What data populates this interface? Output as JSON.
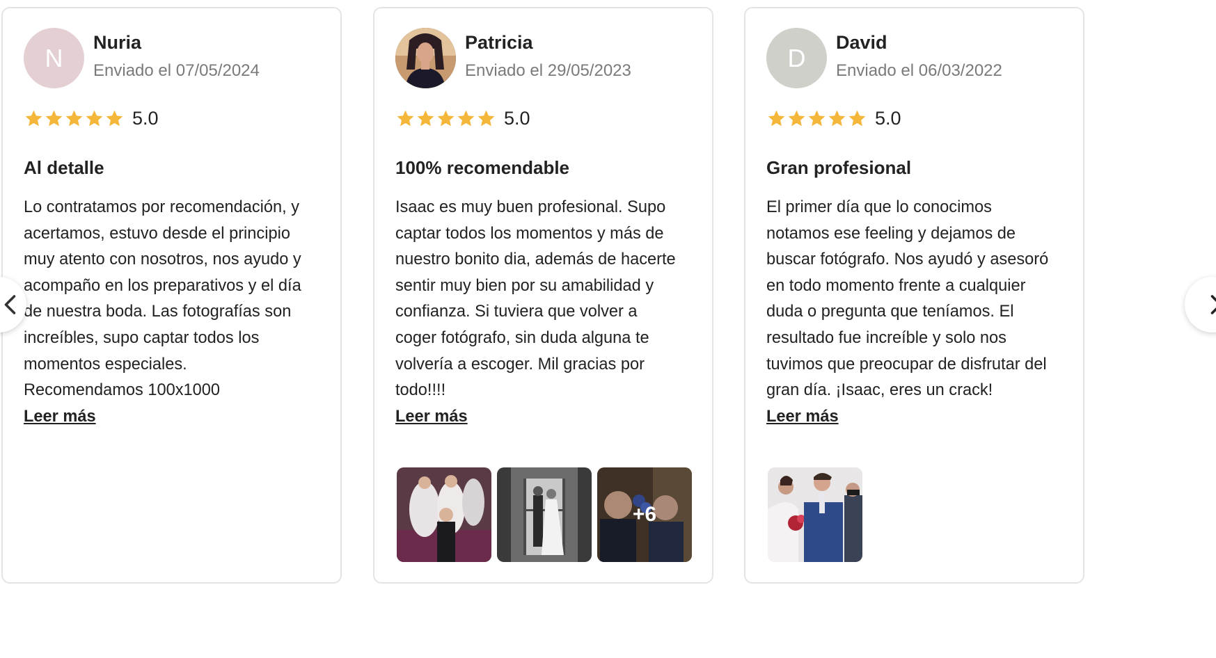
{
  "colors": {
    "star": "#f4b73a",
    "avatar_nuria": "#e4cfd3",
    "avatar_david": "#cfd0c9",
    "muted_text": "#7a7a7a"
  },
  "icons": {
    "prev": "chevron-left-icon",
    "next": "chevron-right-icon",
    "star": "star-icon"
  },
  "reviews": [
    {
      "initial": "N",
      "name": "Nuria",
      "date": "Enviado el 07/05/2024",
      "rating": 5,
      "score": "5.0",
      "title": "Al detalle",
      "body_lines": [
        "Lo contratamos por recomendación, y",
        "acertamos, estuvo desde el principio",
        "muy atento con nosotros, nos ayudo y",
        "acompaño en los preparativos y el día",
        "de nuestra boda. Las fotografías son",
        "increíbles, supo captar todos los",
        "momentos especiales.",
        "Recomendamos 100x1000"
      ],
      "more_label": "Leer más"
    },
    {
      "initial": "",
      "name": "Patricia",
      "date": "Enviado el 29/05/2023",
      "rating": 5,
      "score": "5.0",
      "title": "100% recomendable",
      "body_lines": [
        "Isaac es muy buen profesional. Supo",
        "captar todos los momentos y más de",
        "nuestro bonito dia, además de hacerte",
        "sentir muy bien por su amabilidad y",
        "confianza. Si tuviera que volver a",
        "coger fotógrafo, sin duda alguna te",
        "volvería a escoger. Mil gracias por",
        "todo!!!!"
      ],
      "more_label": "Leer más",
      "extra_photos": "+6"
    },
    {
      "initial": "D",
      "name": "David",
      "date": "Enviado el 06/03/2022",
      "rating": 5,
      "score": "5.0",
      "title": "Gran profesional",
      "body_lines": [
        "El primer día que lo conocimos",
        "notamos ese feeling y dejamos de",
        "buscar fotógrafo. Nos ayudó y asesoró",
        "en todo momento frente a cualquier",
        "duda o pregunta que teníamos. El",
        "resultado fue increíble y solo nos",
        "tuvimos que preocupar de disfrutar del",
        "gran día. ¡Isaac, eres un crack!"
      ],
      "more_label": "Leer más"
    }
  ]
}
